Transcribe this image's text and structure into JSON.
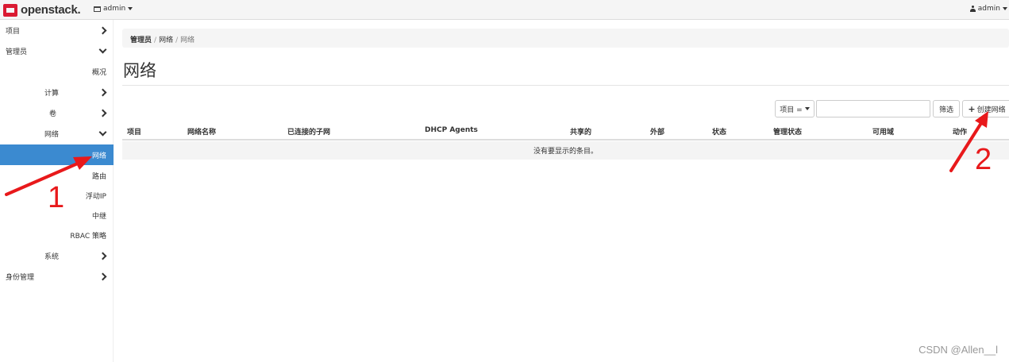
{
  "header": {
    "logo_text": "openstack.",
    "project_label": "admin",
    "user_label": "admin"
  },
  "sidebar": {
    "project": "项目",
    "admin": "管理员",
    "overview": "概况",
    "compute": "计算",
    "volume": "卷",
    "network": "网络",
    "network_sub": "网络",
    "routers": "路由",
    "floating_ip": "浮动IP",
    "trunks": "中继",
    "rbac": "RBAC 策略",
    "system": "系统",
    "identity": "身份管理"
  },
  "breadcrumb": {
    "items": [
      "管理员",
      "网络",
      "网络"
    ]
  },
  "page": {
    "title": "网络"
  },
  "toolbar": {
    "filter_field": "项目 =",
    "filter_value": "",
    "filter_button": "筛选",
    "create_button": "创建网络"
  },
  "table": {
    "columns": [
      "项目",
      "网络名称",
      "已连接的子网",
      "DHCP Agents",
      "共享的",
      "外部",
      "状态",
      "管理状态",
      "可用域",
      "动作"
    ],
    "empty_message": "没有要显示的条目。"
  },
  "annotations": {
    "label_1": "1",
    "label_2": "2",
    "color": "#e8191b"
  },
  "watermark": "CSDN @Allen__l"
}
